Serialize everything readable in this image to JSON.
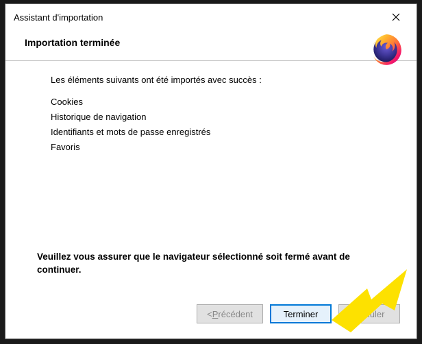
{
  "titlebar": {
    "title": "Assistant d'importation"
  },
  "header": {
    "title": "Importation terminée"
  },
  "content": {
    "success_msg": "Les éléments suivants ont été importés avec succès :",
    "items": [
      "Cookies",
      "Historique de navigation",
      "Identifiants et mots de passe enregistrés",
      "Favoris"
    ],
    "warning": "Veuillez vous assurer que le navigateur sélectionné soit fermé avant de continuer."
  },
  "buttons": {
    "back_prefix": "< ",
    "back_under": "P",
    "back_rest": "récédent",
    "finish": "Terminer",
    "cancel": "Annuler"
  }
}
